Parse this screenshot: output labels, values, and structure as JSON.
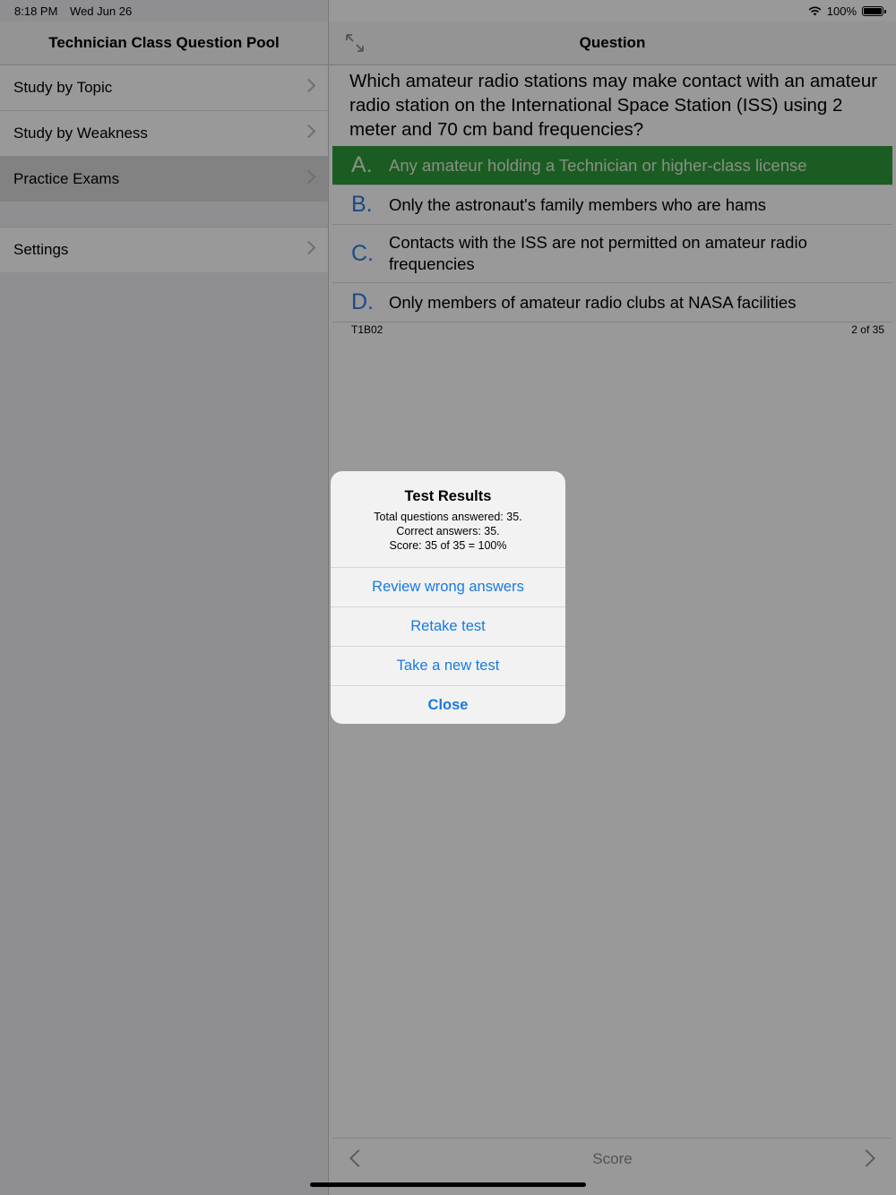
{
  "status": {
    "time": "8:18 PM",
    "date": "Wed Jun 26",
    "battery": "100%",
    "icons": [
      "wifi-icon",
      "battery-icon"
    ]
  },
  "master": {
    "title": "Technician Class Question Pool",
    "items": [
      {
        "label": "Study by Topic"
      },
      {
        "label": "Study by Weakness"
      },
      {
        "label": "Practice Exams",
        "selected": true
      }
    ],
    "settings_label": "Settings"
  },
  "detail": {
    "title": "Question",
    "question": "Which amateur radio stations may make contact with an amateur radio station on the International Space Station (ISS) using 2 meter and 70 cm band frequencies?",
    "answers": [
      {
        "letter": "A.",
        "text": "Any amateur holding a Technician or higher-class license",
        "correct": true
      },
      {
        "letter": "B.",
        "text": "Only the astronaut's family members who are hams"
      },
      {
        "letter": "C.",
        "text": "Contacts with the ISS are not permitted on amateur radio frequencies"
      },
      {
        "letter": "D.",
        "text": "Only members of amateur radio clubs at NASA facilities"
      }
    ],
    "question_code": "T1B02",
    "position": "2 of 35",
    "toolbar_score": "Score"
  },
  "alert": {
    "title": "Test Results",
    "line1": "Total questions answered: 35.",
    "line2": "Correct answers: 35.",
    "line3": "Score: 35 of 35 = 100%",
    "buttons": [
      "Review wrong answers",
      "Retake test",
      "Take a new test",
      "Close"
    ]
  },
  "colors": {
    "accent": "#1a7ae0",
    "correct_bg": "#2e9a3b"
  }
}
